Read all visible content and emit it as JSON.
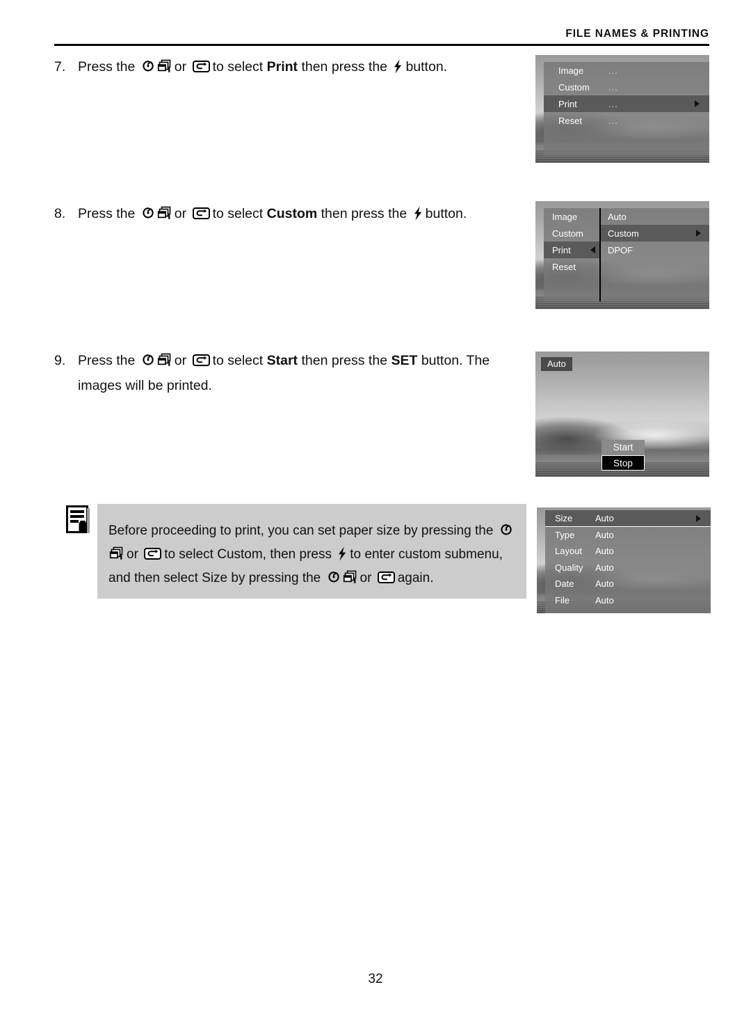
{
  "header": {
    "title": "FILE NAMES & PRINTING"
  },
  "icons": {
    "timer": "self-timer-icon",
    "burst": "continuous-shooting-icon",
    "return": "return-arrow-icon",
    "flash": "flash-icon",
    "note": "note-pencil-icon"
  },
  "steps": [
    {
      "number": "7.",
      "parts": [
        {
          "t": "text",
          "v": "Press the "
        },
        {
          "t": "icon",
          "v": "timer"
        },
        {
          "t": "icon",
          "v": "burst"
        },
        {
          "t": "text",
          "v": "or "
        },
        {
          "t": "icon",
          "v": "return"
        },
        {
          "t": "text",
          "v": "to select "
        },
        {
          "t": "bold",
          "v": "Print"
        },
        {
          "t": "text",
          "v": " then press the "
        },
        {
          "t": "icon",
          "v": "flash"
        },
        {
          "t": "text",
          "v": "button."
        }
      ]
    },
    {
      "number": "8.",
      "parts": [
        {
          "t": "text",
          "v": "Press the "
        },
        {
          "t": "icon",
          "v": "timer"
        },
        {
          "t": "icon",
          "v": "burst"
        },
        {
          "t": "text",
          "v": "or "
        },
        {
          "t": "icon",
          "v": "return"
        },
        {
          "t": "text",
          "v": "to select "
        },
        {
          "t": "bold",
          "v": "Custom"
        },
        {
          "t": "text",
          "v": " then press the "
        },
        {
          "t": "icon",
          "v": "flash"
        },
        {
          "t": "text",
          "v": "button."
        }
      ]
    },
    {
      "number": "9.",
      "parts": [
        {
          "t": "text",
          "v": "Press the "
        },
        {
          "t": "icon",
          "v": "timer"
        },
        {
          "t": "icon",
          "v": "burst"
        },
        {
          "t": "text",
          "v": "or "
        },
        {
          "t": "icon",
          "v": "return"
        },
        {
          "t": "text",
          "v": "to select "
        },
        {
          "t": "bold",
          "v": "Start"
        },
        {
          "t": "text",
          "v": " then press the "
        },
        {
          "t": "bold",
          "v": "SET"
        },
        {
          "t": "text",
          "v": " button. The images will be printed."
        }
      ]
    }
  ],
  "note": {
    "parts": [
      {
        "t": "text",
        "v": "Before proceeding to print, you can set paper size by pressing the "
      },
      {
        "t": "icon",
        "v": "timer"
      },
      {
        "t": "icon",
        "v": "burst"
      },
      {
        "t": "text",
        "v": "or "
      },
      {
        "t": "icon",
        "v": "return"
      },
      {
        "t": "text",
        "v": "to select Custom, then press "
      },
      {
        "t": "icon",
        "v": "flash"
      },
      {
        "t": "text",
        "v": "to enter custom submenu, and then select Size by pressing the "
      },
      {
        "t": "icon",
        "v": "timer"
      },
      {
        "t": "icon",
        "v": "burst"
      },
      {
        "t": "text",
        "v": "or "
      },
      {
        "t": "icon",
        "v": "return"
      },
      {
        "t": "text",
        "v": "again."
      }
    ]
  },
  "screens": {
    "print_menu": {
      "rows": [
        {
          "label": "Image",
          "value": "...",
          "selected": false,
          "caret": ""
        },
        {
          "label": "Custom",
          "value": "...",
          "selected": false,
          "caret": ""
        },
        {
          "label": "Print",
          "value": "...",
          "selected": true,
          "caret": "right"
        },
        {
          "label": "Reset",
          "value": "...",
          "selected": false,
          "caret": ""
        }
      ]
    },
    "custom_menu": {
      "left_rows": [
        {
          "label": "Image",
          "selected": false,
          "caret": ""
        },
        {
          "label": "Custom",
          "selected": false,
          "caret": ""
        },
        {
          "label": "Print",
          "selected": true,
          "caret": "left"
        },
        {
          "label": "Reset",
          "selected": false,
          "caret": ""
        }
      ],
      "right_rows": [
        {
          "label": "Auto",
          "selected": false,
          "caret": ""
        },
        {
          "label": "Custom",
          "selected": true,
          "caret": "right"
        },
        {
          "label": "DPOF",
          "selected": false,
          "caret": ""
        }
      ]
    },
    "start_stop": {
      "badge": "Auto",
      "buttons": [
        {
          "label": "Start",
          "selected": false
        },
        {
          "label": "Stop",
          "selected": true
        }
      ]
    },
    "paper_menu": {
      "rows": [
        {
          "label": "Size",
          "value": "Auto",
          "selected": true,
          "caret": "right"
        },
        {
          "label": "Type",
          "value": "Auto",
          "selected": false,
          "caret": ""
        },
        {
          "label": "Layout",
          "value": "Auto",
          "selected": false,
          "caret": ""
        },
        {
          "label": "Quality",
          "value": "Auto",
          "selected": false,
          "caret": ""
        },
        {
          "label": "Date",
          "value": "Auto",
          "selected": false,
          "caret": ""
        },
        {
          "label": "File",
          "value": "Auto",
          "selected": false,
          "caret": ""
        }
      ]
    }
  },
  "footer": {
    "page_number": "32"
  },
  "colors": {
    "note_background": "#cccccc",
    "menu_panel": "#787878",
    "menu_selected": "#5a5a5a",
    "badge": "#4a4a4a",
    "text": "#111111"
  }
}
